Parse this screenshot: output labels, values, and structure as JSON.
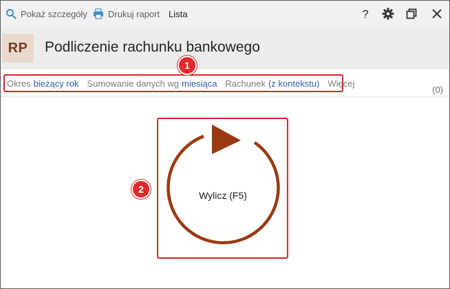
{
  "toolbar": {
    "show_details": "Pokaż szczegóły",
    "print_report": "Drukuj raport",
    "list": "Lista"
  },
  "window_controls": {
    "help_icon": "help-icon",
    "settings_icon": "gear-icon",
    "restore_icon": "restore-icon",
    "close_icon": "close-icon"
  },
  "header": {
    "badge": "RP",
    "title": "Podliczenie rachunku bankowego"
  },
  "filters": {
    "period_label": "Okres",
    "period_value": "bieżący rok",
    "sum_label": "Sumowanie danych wg",
    "sum_value": "miesiąca",
    "account_label": "Rachunek",
    "account_value": "(z kontekstu)",
    "more": "Więcej",
    "count": "(0)"
  },
  "callouts": {
    "one": "1",
    "two": "2"
  },
  "refresh": {
    "label": "Wylicz (F5)"
  },
  "colors": {
    "accent_red": "#e0202a",
    "refresh_brown": "#9a3a12",
    "link_blue": "#2c5fae",
    "badge_bg": "#ead8cf"
  }
}
